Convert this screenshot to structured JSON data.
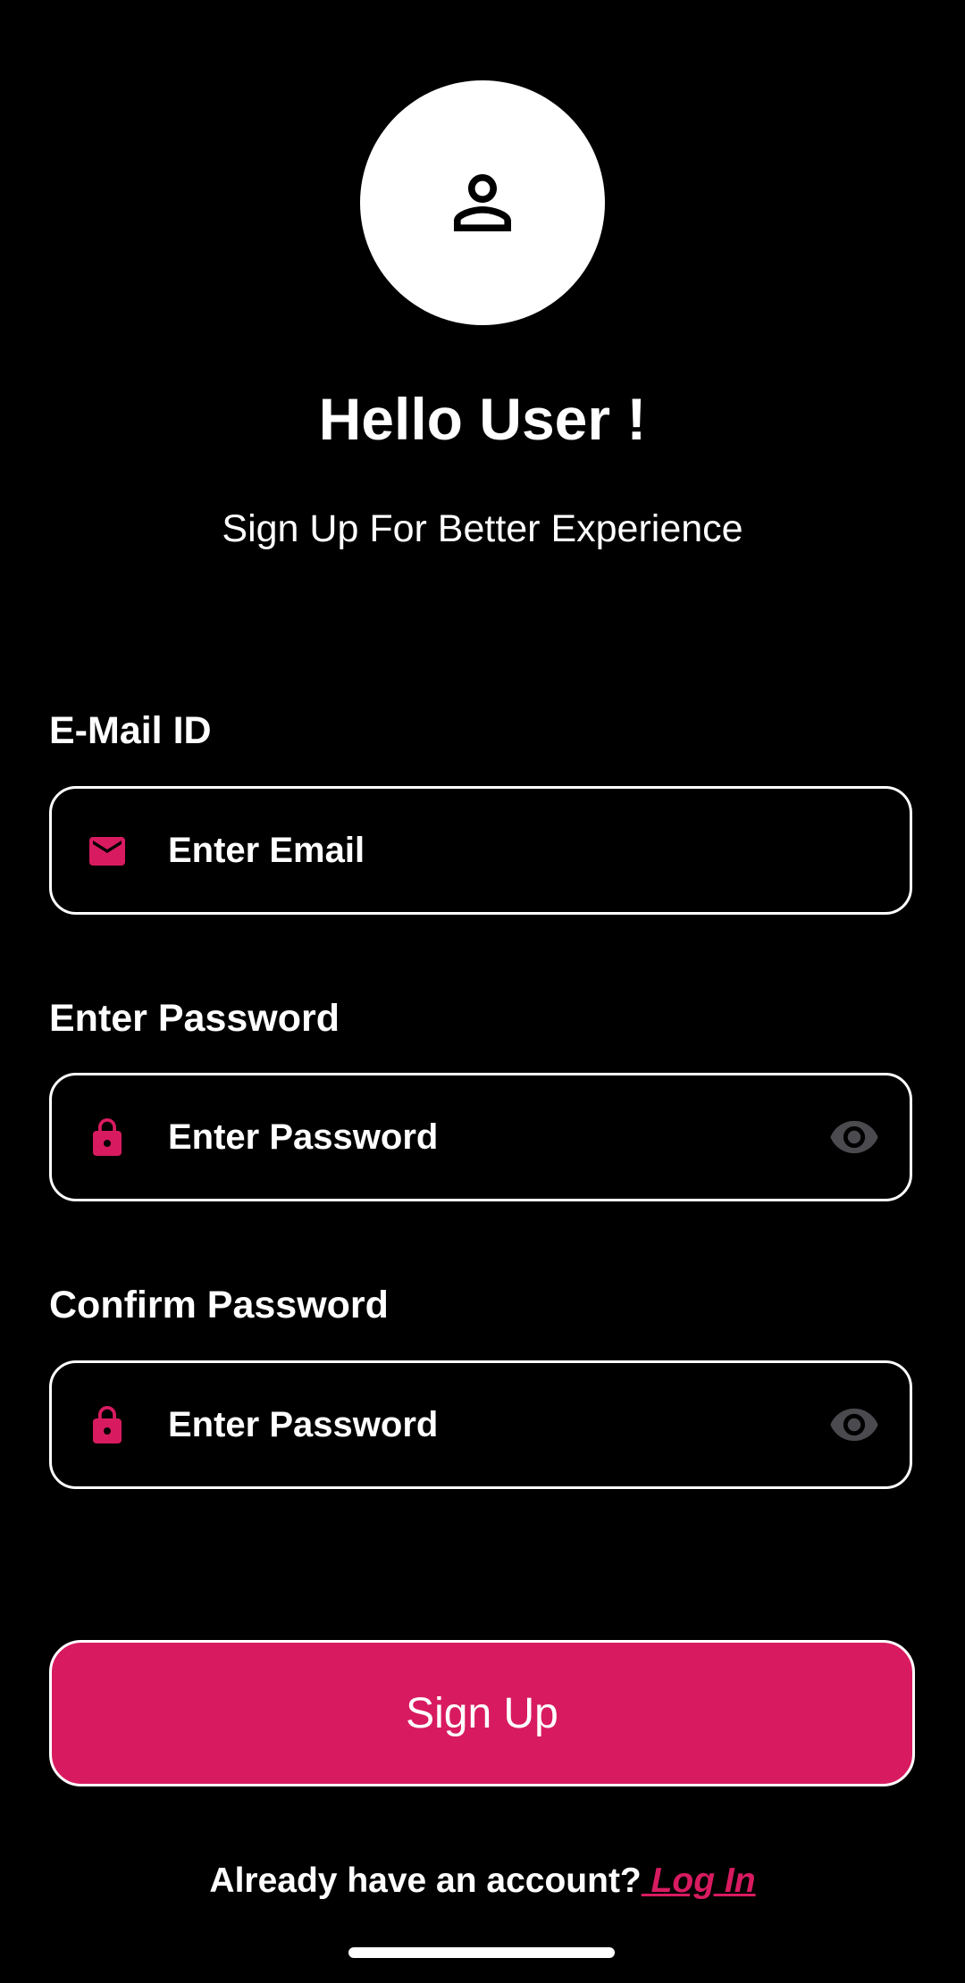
{
  "header": {
    "title": "Hello User !",
    "subtitle": "Sign Up For Better Experience",
    "avatar_icon": "person-outline-icon"
  },
  "form": {
    "email": {
      "label": "E-Mail ID",
      "placeholder": "Enter Email",
      "value": "",
      "icon": "mail-icon"
    },
    "password": {
      "label": "Enter Password",
      "placeholder": "Enter Password",
      "value": "",
      "icon": "lock-icon",
      "toggle_icon": "eye-icon"
    },
    "confirm_password": {
      "label": "Confirm Password",
      "placeholder": "Enter Password",
      "value": "",
      "icon": "lock-icon",
      "toggle_icon": "eye-icon"
    },
    "submit_label": "Sign Up"
  },
  "footer": {
    "prompt": "Already have an account?",
    "link_label": " Log In"
  },
  "colors": {
    "accent": "#d81b60",
    "background": "#000000",
    "text": "#ffffff",
    "toggle_icon": "#4a4a4f"
  }
}
